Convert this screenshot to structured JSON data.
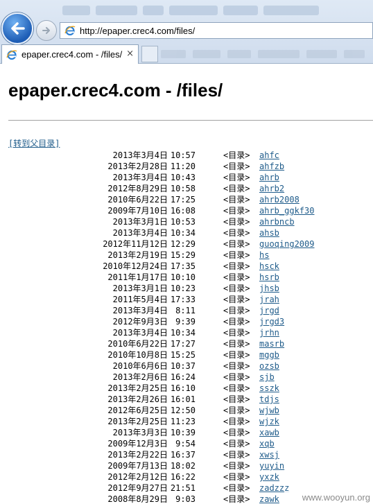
{
  "browser": {
    "url": "http://epaper.crec4.com/files/",
    "tab_title": "epaper.crec4.com - /files/",
    "tab_close": "×"
  },
  "page": {
    "title": "epaper.crec4.com - /files/",
    "parent_link": "[转到父目录]",
    "entries": [
      {
        "date": "2013年3月4日",
        "time": "10:57",
        "type": "<目录>",
        "name": "ahfc"
      },
      {
        "date": "2013年2月28日",
        "time": "11:20",
        "type": "<目录>",
        "name": "ahfzb"
      },
      {
        "date": "2013年3月4日",
        "time": "10:43",
        "type": "<目录>",
        "name": "ahrb"
      },
      {
        "date": "2012年8月29日",
        "time": "10:58",
        "type": "<目录>",
        "name": "ahrb2"
      },
      {
        "date": "2010年6月22日",
        "time": "17:25",
        "type": "<目录>",
        "name": "ahrb2008"
      },
      {
        "date": "2009年7月10日",
        "time": "16:08",
        "type": "<目录>",
        "name": "ahrb_ggkf30"
      },
      {
        "date": "2013年3月1日",
        "time": "10:53",
        "type": "<目录>",
        "name": "ahrbncb"
      },
      {
        "date": "2013年3月4日",
        "time": "10:34",
        "type": "<目录>",
        "name": "ahsb"
      },
      {
        "date": "2012年11月12日",
        "time": "12:29",
        "type": "<目录>",
        "name": "guoqing2009"
      },
      {
        "date": "2013年2月19日",
        "time": "15:29",
        "type": "<目录>",
        "name": "hs"
      },
      {
        "date": "2010年12月24日",
        "time": "17:35",
        "type": "<目录>",
        "name": "hsck"
      },
      {
        "date": "2011年1月17日",
        "time": "10:10",
        "type": "<目录>",
        "name": "hsrb"
      },
      {
        "date": "2013年3月1日",
        "time": "10:23",
        "type": "<目录>",
        "name": "jhsb"
      },
      {
        "date": "2011年5月4日",
        "time": "17:33",
        "type": "<目录>",
        "name": "jrah"
      },
      {
        "date": "2013年3月4日",
        "time": "8:11",
        "type": "<目录>",
        "name": "jrgd"
      },
      {
        "date": "2012年9月3日",
        "time": "9:39",
        "type": "<目录>",
        "name": "jrgd3"
      },
      {
        "date": "2013年3月4日",
        "time": "10:34",
        "type": "<目录>",
        "name": "jrhn"
      },
      {
        "date": "2010年6月22日",
        "time": "17:27",
        "type": "<目录>",
        "name": "masrb"
      },
      {
        "date": "2010年10月8日",
        "time": "15:25",
        "type": "<目录>",
        "name": "mggb"
      },
      {
        "date": "2010年6月6日",
        "time": "10:37",
        "type": "<目录>",
        "name": "ozsb"
      },
      {
        "date": "2013年2月6日",
        "time": "16:24",
        "type": "<目录>",
        "name": "sjb"
      },
      {
        "date": "2013年2月25日",
        "time": "16:10",
        "type": "<目录>",
        "name": "sszk"
      },
      {
        "date": "2013年2月26日",
        "time": "16:01",
        "type": "<目录>",
        "name": "tdjs"
      },
      {
        "date": "2012年6月25日",
        "time": "12:50",
        "type": "<目录>",
        "name": "wjwb"
      },
      {
        "date": "2013年2月25日",
        "time": "11:23",
        "type": "<目录>",
        "name": "wjzk"
      },
      {
        "date": "2013年3月3日",
        "time": "10:39",
        "type": "<目录>",
        "name": "xawb"
      },
      {
        "date": "2009年12月3日",
        "time": "9:54",
        "type": "<目录>",
        "name": "xqb"
      },
      {
        "date": "2013年2月22日",
        "time": "16:37",
        "type": "<目录>",
        "name": "xwsj"
      },
      {
        "date": "2009年7月13日",
        "time": "18:02",
        "type": "<目录>",
        "name": "yuyin"
      },
      {
        "date": "2012年2月12日",
        "time": "16:22",
        "type": "<目录>",
        "name": "yxzk"
      },
      {
        "date": "2012年9月27日",
        "time": "21:51",
        "type": "<目录>",
        "name": "zadzzz"
      },
      {
        "date": "2008年8月29日",
        "time": "9:03",
        "type": "<目录>",
        "name": "zawk"
      }
    ]
  },
  "watermark": "www.wooyun.org",
  "colors": {
    "link": "#1e5b8a",
    "back_button": "#1d5db5",
    "ie_logo": "#2a7fd4"
  },
  "icons": {
    "back": "back-arrow-icon",
    "forward": "forward-arrow-icon",
    "browser": "ie-logo-icon"
  }
}
